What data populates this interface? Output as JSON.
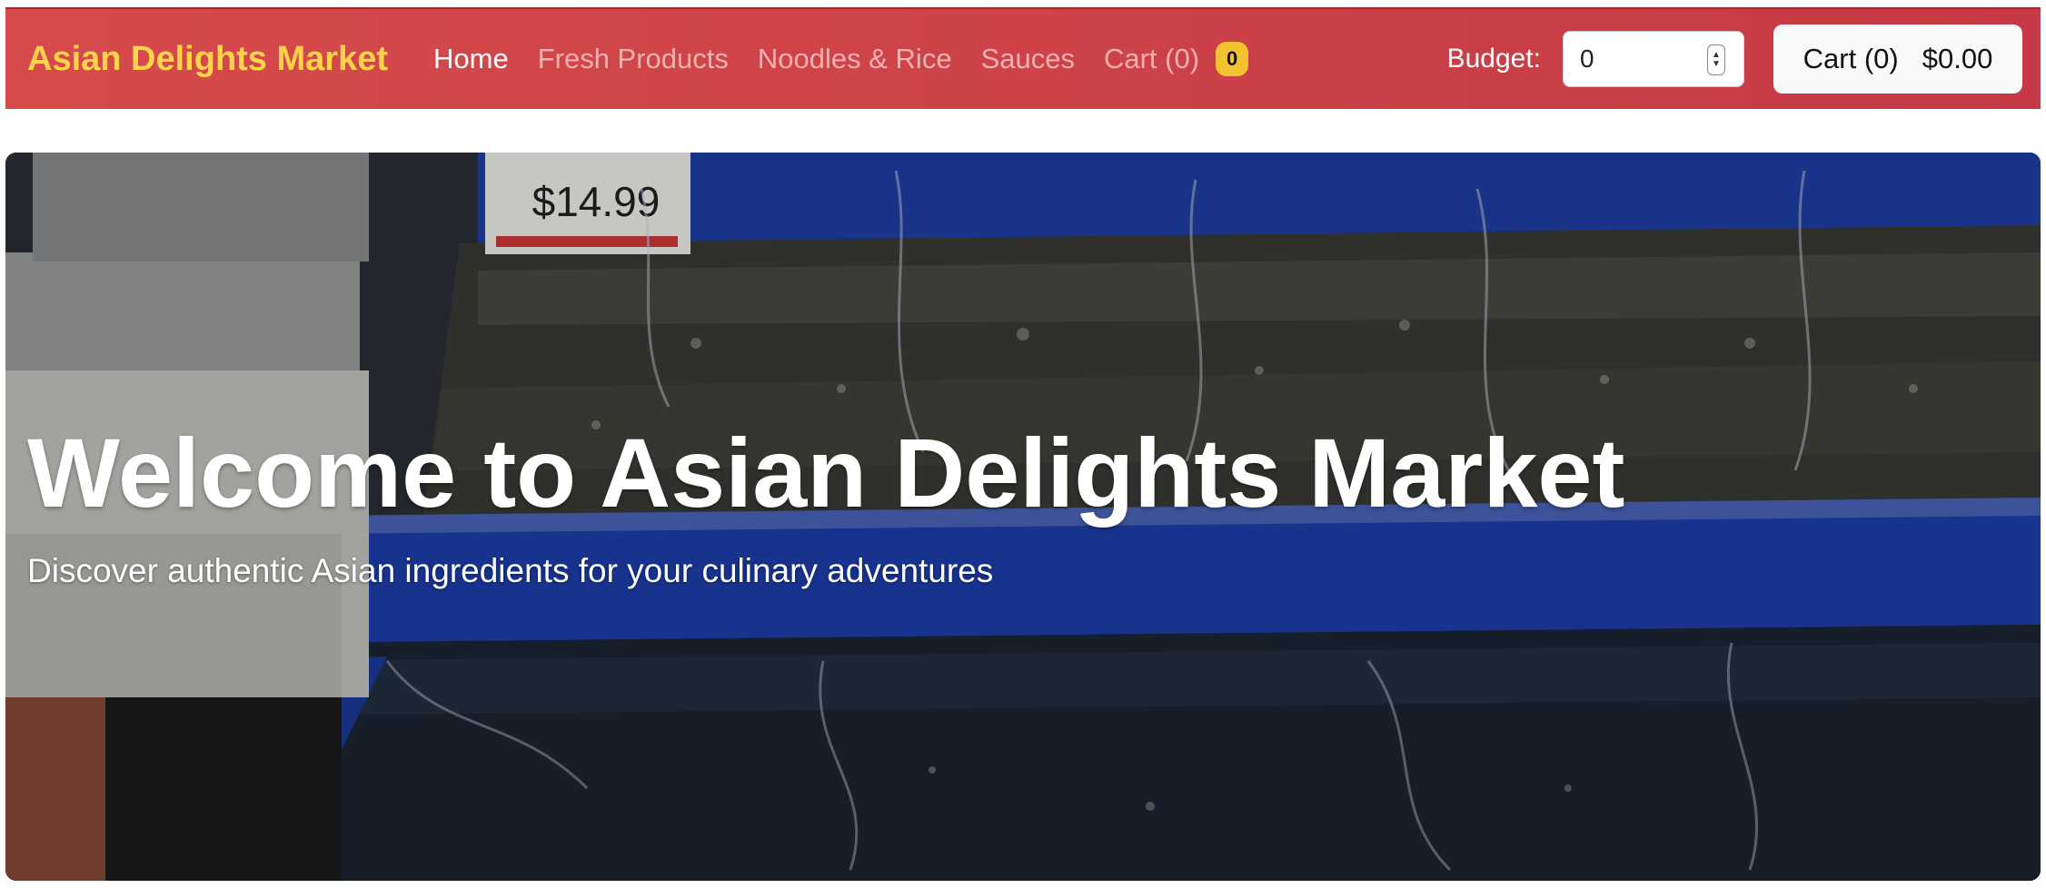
{
  "navbar": {
    "brand": "Asian Delights Market",
    "links": [
      {
        "label": "Home",
        "active": true
      },
      {
        "label": "Fresh Products",
        "active": false
      },
      {
        "label": "Noodles & Rice",
        "active": false
      },
      {
        "label": "Sauces",
        "active": false
      }
    ],
    "cart_link": {
      "label": "Cart (0)",
      "badge": "0"
    },
    "budget": {
      "label": "Budget:",
      "value": "0"
    },
    "cart_button": {
      "label": "Cart (0)",
      "total": "$0.00"
    }
  },
  "hero": {
    "title": "Welcome to Asian Delights Market",
    "subtitle": "Discover authentic Asian ingredients for your culinary adventures",
    "price_tag": "$14.99"
  },
  "colors": {
    "navbar": "#cc4148",
    "brand": "#ffd34a",
    "badge": "#f2c230",
    "hero_tank_blue": "#1e3fa8"
  }
}
